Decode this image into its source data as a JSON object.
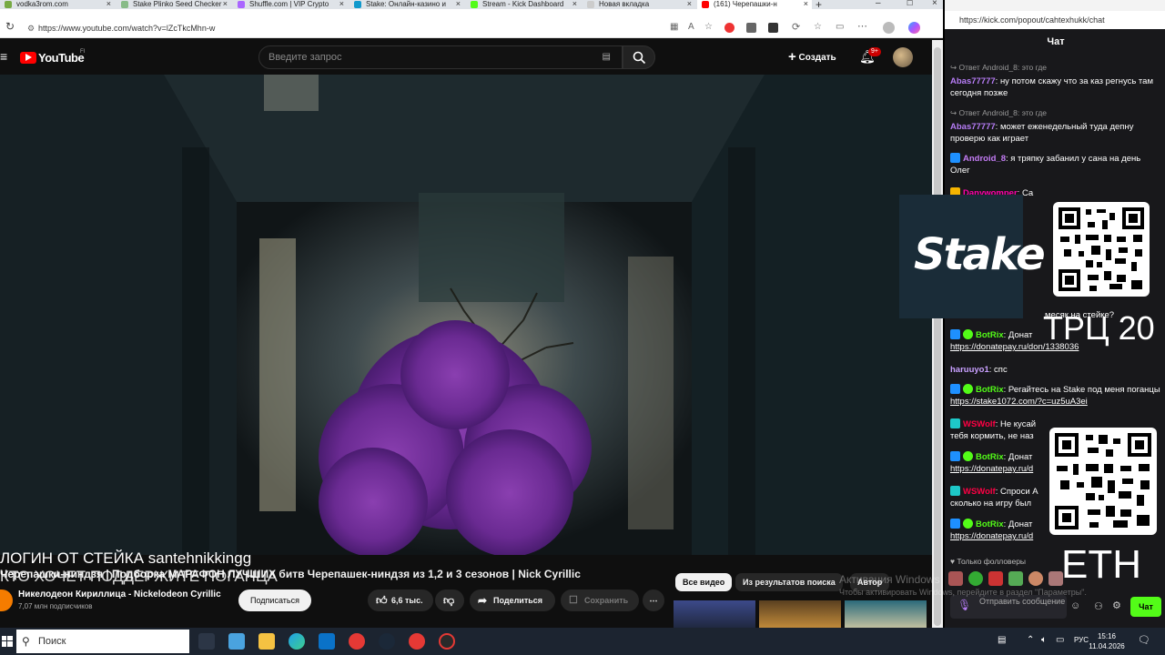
{
  "browser_tabs": [
    {
      "label": "vodka3rom.com",
      "color": "#7a4"
    },
    {
      "label": "Stake Plinko Seed Checker",
      "color": "#8b8"
    },
    {
      "label": "Shuffle.com | VIP Crypto",
      "color": "#a6f"
    },
    {
      "label": "Stake: Онлайн-казино и",
      "color": "#19c"
    },
    {
      "label": "Stream - Kick Dashboard",
      "color": "#53fc18"
    },
    {
      "label": "Новая вкладка",
      "color": "#ccc"
    },
    {
      "label": "(161) Черепашки-н",
      "color": "#f00"
    }
  ],
  "address_bar": {
    "url": "https://www.youtube.com/watch?v=lZcTkcMhn-w"
  },
  "youtube": {
    "logo": "YouTube",
    "region": "FI",
    "search_placeholder": "Введите запрос",
    "create_label": "Создать",
    "notif_count": "9+",
    "video_title": "Черепашки-ниндзя | Подборка МАРАФОН ЛУЧШИХ битв Черепашек-ниндзя из 1,2 и 3 сезонов | Nick Cyrillic",
    "overlay_line1": "ЛОГИН ОТ СТЕЙКА santehnikkingg",
    "overlay_line2": "КТО ХОЧЕТ ПОДДЕРЖИТЕ ПОГАНЦА",
    "channel_name": "Никелодеон Кириллица - Nickelodeon Cyrillic",
    "subscribers": "7,07 млн подписчиков",
    "subscribe_label": "Подписаться",
    "likes": "6,6 тыс.",
    "share_label": "Поделиться",
    "save_label": "Сохранить",
    "chips": [
      "Все видео",
      "Из результатов поиска",
      "Автор"
    ]
  },
  "kick": {
    "url": "https://kick.com/popout/cahtexhukk/chat",
    "header": "Чат",
    "messages": [
      {
        "reply": "Ответ Android_8: это где",
        "user": "Abas77777",
        "user_color": "#b67cf5",
        "text": "ну потом скажу что за каз регнусь там сегодня позже"
      },
      {
        "reply": "Ответ Android_8: это где",
        "user": "Abas77777",
        "user_color": "#b67cf5",
        "text": "может еженедельный туда депну проверю как играет"
      },
      {
        "user": "Android_8",
        "user_color": "#c47cf5",
        "text": "я тряпку забанил у сана на день Олег"
      },
      {
        "user": "Danywomper",
        "user_color": "#f0a",
        "text": "Са"
      },
      {
        "text": "месяк на стейке?"
      },
      {
        "user": "BotRix",
        "user_color": "#53fc18",
        "text": "Донат",
        "link": "https://donatepay.ru/don/1338036"
      },
      {
        "user": "haruuyo1",
        "user_color": "#c9a0ff",
        "text": "спс"
      },
      {
        "user": "BotRix",
        "user_color": "#53fc18",
        "text": "Регайтесь на Stake под меня поганцы",
        "link": "https://stake1072.com/?c=uz5uA3ei"
      },
      {
        "user": "WSWolf",
        "user_color": "#f04",
        "text": "Не кусай тебя кормить, не наз"
      },
      {
        "user": "BotRix",
        "user_color": "#53fc18",
        "text": "Донат",
        "link": "https://donatepay.ru/d"
      },
      {
        "user": "WSWolf",
        "user_color": "#f04",
        "text": "Спроси А сколько на игру был"
      },
      {
        "user": "BotRix",
        "user_color": "#53fc18",
        "text": "Донат",
        "link": "https://donatepay.ru/d"
      }
    ],
    "followers_only": "Только фолловеры",
    "send_placeholder": "Отправить сообщение",
    "chat_button": "Чат"
  },
  "overlays": {
    "stake_logo": "Stake",
    "trc_label": "ТРЦ 20",
    "eth_label": "ETH",
    "windows_watermark_1": "Активация Windows",
    "windows_watermark_2": "Чтобы активировать Windows, перейдите в раздел \"Параметры\"."
  },
  "taskbar": {
    "search_label": "Поиск",
    "lang": "РУС",
    "time": "15:16",
    "date": "11.04.2026"
  }
}
